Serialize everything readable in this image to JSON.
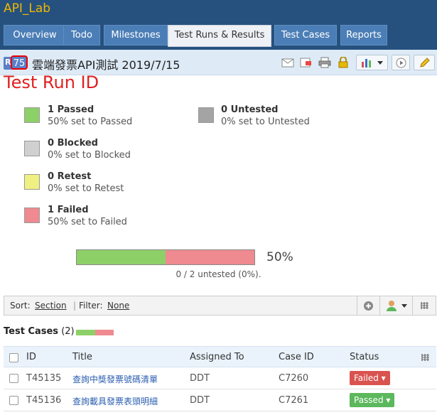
{
  "app": {
    "title": "API_Lab"
  },
  "tabs": [
    {
      "label": "Overview"
    },
    {
      "label": "Todo"
    },
    {
      "label": "Milestones"
    },
    {
      "label": "Test Runs & Results"
    },
    {
      "label": "Test Cases"
    },
    {
      "label": "Reports"
    }
  ],
  "run": {
    "prefix": "R",
    "id": "75",
    "title": "雲端發票API測試 2019/7/15"
  },
  "annotation": "Test Run ID",
  "stats": [
    {
      "count": "1 Passed",
      "desc": "50% set to Passed",
      "color": "#8ed068"
    },
    {
      "count": "0 Blocked",
      "desc": "0% set to Blocked",
      "color": "#d0d0d0"
    },
    {
      "count": "0 Retest",
      "desc": "0% set to Retest",
      "color": "#eef082"
    },
    {
      "count": "1 Failed",
      "desc": "50% set to Failed",
      "color": "#ef8a90"
    },
    {
      "count": "0 Untested",
      "desc": "0% set to Untested",
      "color": "#a4a4a4"
    }
  ],
  "progress": {
    "passed_fraction": 0.5,
    "failed_fraction": 0.5,
    "percent_text": "50%",
    "untested_text": "0 / 2 untested (0%)."
  },
  "sortbar": {
    "sort_label": "Sort:",
    "sort_value": "Section",
    "filter_label": "Filter:",
    "filter_value": "None"
  },
  "test_cases": {
    "title": "Test Cases",
    "count": "(2)"
  },
  "table": {
    "columns": [
      "ID",
      "Title",
      "Assigned To",
      "Case ID",
      "Status"
    ],
    "rows": [
      {
        "id": "T45135",
        "title": "查詢中獎發票號碼清單",
        "assigned": "DDT",
        "case_id": "C7260",
        "status": "Failed ▾",
        "status_color": "#d9534f"
      },
      {
        "id": "T45136",
        "title": "查詢載具發票表頭明細",
        "assigned": "DDT",
        "case_id": "C7261",
        "status": "Passed ▾",
        "status_color": "#5cb85c"
      }
    ]
  },
  "colors": {
    "header": "#26517f",
    "tab": "#4b7eb6",
    "accent": "#f0b800"
  }
}
